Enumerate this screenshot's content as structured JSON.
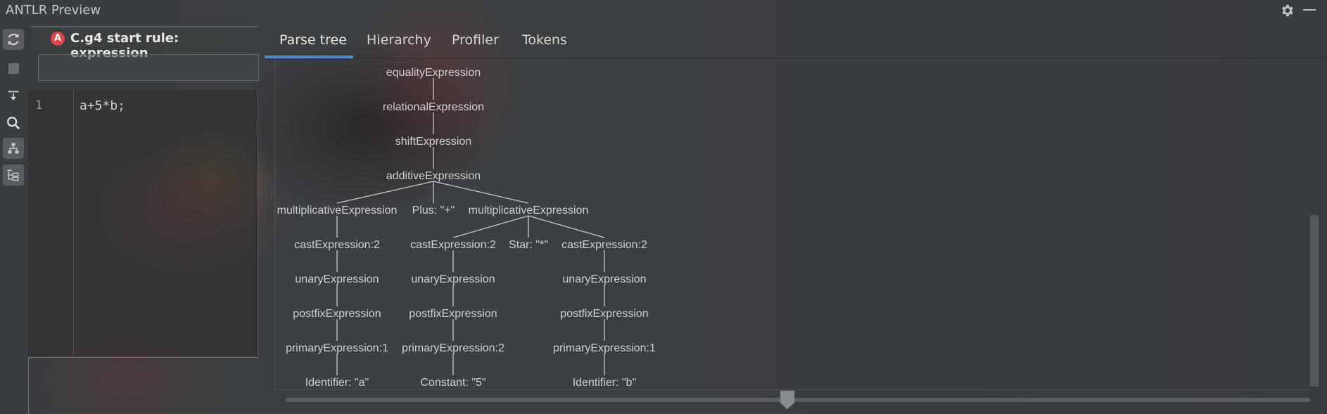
{
  "window": {
    "title": "ANTLR Preview"
  },
  "toolbar": {
    "icons": [
      "refresh-icon",
      "stop-icon",
      "import-icon",
      "search-icon",
      "hierarchy-icon",
      "tree-folder-icon"
    ]
  },
  "editor_tab": {
    "badge": "A",
    "label": "C.g4 start rule: expression"
  },
  "editor": {
    "line_numbers": [
      "1"
    ],
    "lines": [
      "a+5*b;"
    ]
  },
  "view_tabs": [
    {
      "label": "Parse tree",
      "selected": true
    },
    {
      "label": "Hierarchy",
      "selected": false
    },
    {
      "label": "Profiler",
      "selected": false
    },
    {
      "label": "Tokens",
      "selected": false
    }
  ],
  "parse_tree": {
    "nodes": [
      {
        "id": "n1",
        "label": "equalityExpression"
      },
      {
        "id": "n2",
        "label": "relationalExpression"
      },
      {
        "id": "n3",
        "label": "shiftExpression"
      },
      {
        "id": "n4",
        "label": "additiveExpression"
      },
      {
        "id": "n5",
        "label": "multiplicativeExpression"
      },
      {
        "id": "n6",
        "label": "Plus: \"+\""
      },
      {
        "id": "n7",
        "label": "multiplicativeExpression"
      },
      {
        "id": "n8",
        "label": "castExpression:2"
      },
      {
        "id": "n9",
        "label": "castExpression:2"
      },
      {
        "id": "n10",
        "label": "Star: \"*\""
      },
      {
        "id": "n11",
        "label": "castExpression:2"
      },
      {
        "id": "n12",
        "label": "unaryExpression"
      },
      {
        "id": "n13",
        "label": "unaryExpression"
      },
      {
        "id": "n14",
        "label": "unaryExpression"
      },
      {
        "id": "n15",
        "label": "postfixExpression"
      },
      {
        "id": "n16",
        "label": "postfixExpression"
      },
      {
        "id": "n17",
        "label": "postfixExpression"
      },
      {
        "id": "n18",
        "label": "primaryExpression:1"
      },
      {
        "id": "n19",
        "label": "primaryExpression:2"
      },
      {
        "id": "n20",
        "label": "primaryExpression:1"
      },
      {
        "id": "n21",
        "label": "Identifier: \"a\""
      },
      {
        "id": "n22",
        "label": "Constant: \"5\""
      },
      {
        "id": "n23",
        "label": "Identifier: \"b\""
      }
    ],
    "edges": [
      [
        "n1",
        "n2"
      ],
      [
        "n2",
        "n3"
      ],
      [
        "n3",
        "n4"
      ],
      [
        "n4",
        "n5"
      ],
      [
        "n4",
        "n6"
      ],
      [
        "n4",
        "n7"
      ],
      [
        "n5",
        "n8"
      ],
      [
        "n7",
        "n9"
      ],
      [
        "n7",
        "n10"
      ],
      [
        "n7",
        "n11"
      ],
      [
        "n8",
        "n12"
      ],
      [
        "n9",
        "n13"
      ],
      [
        "n11",
        "n14"
      ],
      [
        "n12",
        "n15"
      ],
      [
        "n13",
        "n16"
      ],
      [
        "n14",
        "n17"
      ],
      [
        "n15",
        "n18"
      ],
      [
        "n16",
        "n19"
      ],
      [
        "n17",
        "n20"
      ],
      [
        "n18",
        "n21"
      ],
      [
        "n19",
        "n22"
      ],
      [
        "n20",
        "n23"
      ]
    ]
  },
  "zoom_slider": {
    "value_fraction": 0.49
  },
  "colors": {
    "accent": "#4a88c7",
    "badge": "#e04545"
  }
}
